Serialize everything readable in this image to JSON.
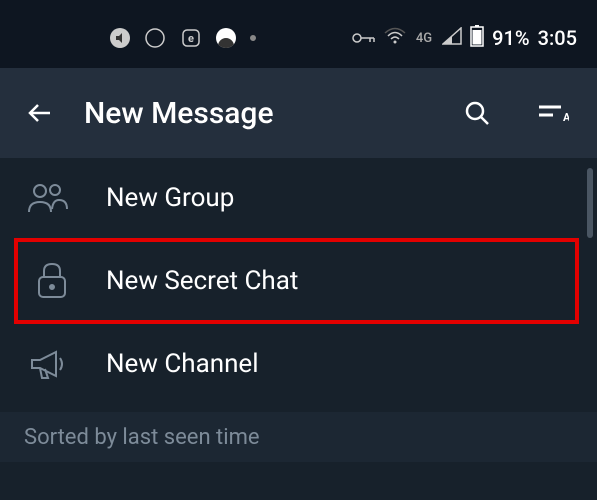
{
  "status_bar": {
    "battery_percent": "91%",
    "time": "3:05",
    "network_label": "4G"
  },
  "app_bar": {
    "title": "New Message"
  },
  "list": {
    "items": [
      {
        "label": "New Group",
        "icon": "group-icon"
      },
      {
        "label": "New Secret Chat",
        "icon": "lock-icon",
        "highlighted": true
      },
      {
        "label": "New Channel",
        "icon": "megaphone-icon"
      }
    ]
  },
  "section_header": "Sorted by last seen time"
}
